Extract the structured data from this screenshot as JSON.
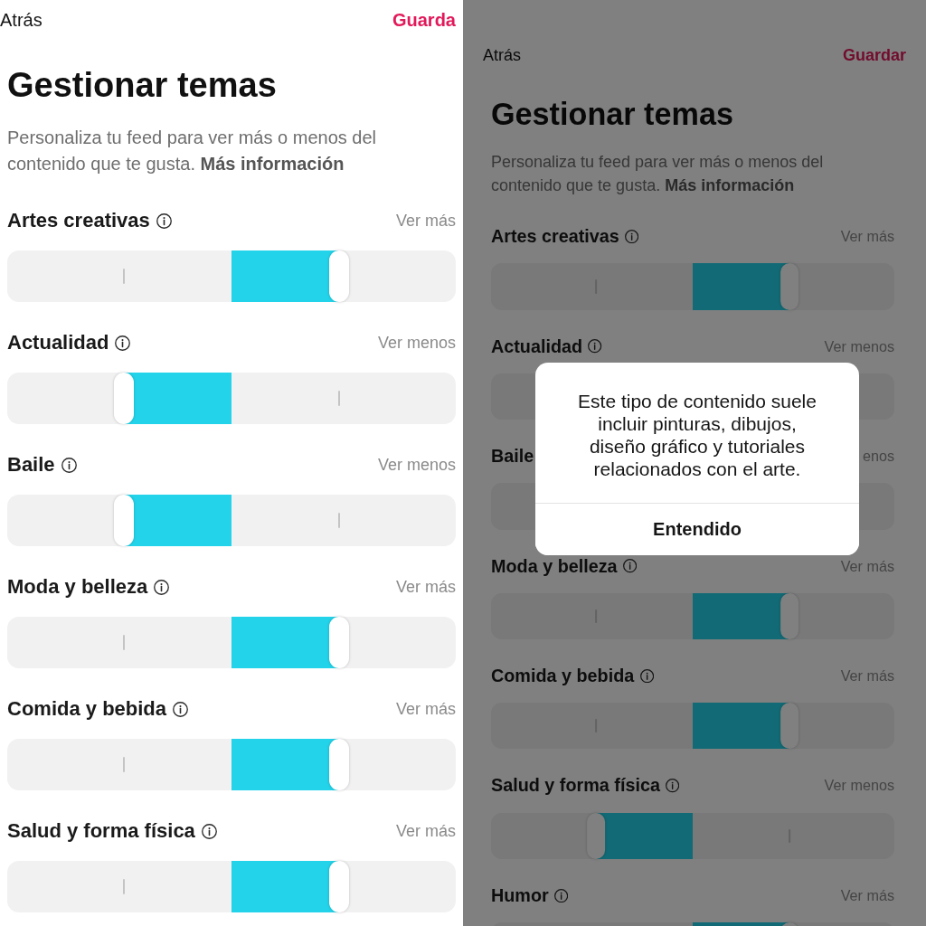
{
  "screens": [
    {
      "dimmed": false,
      "nav": {
        "back": "Atrás",
        "save": "Guarda"
      },
      "title": "Gestionar temas",
      "description": {
        "text": "Personaliza tu feed para ver más o menos del contenido que te gusta.",
        "link": "Más información"
      },
      "topics": [
        {
          "label": "Artes creativas",
          "info": true,
          "preference": "Ver más",
          "level": 0.74
        },
        {
          "label": "Actualidad",
          "info": true,
          "preference": "Ver menos",
          "level": 0.26
        },
        {
          "label": "Baile",
          "info": true,
          "preference": "Ver menos",
          "level": 0.26
        },
        {
          "label": "Moda y belleza",
          "info": true,
          "preference": "Ver más",
          "level": 0.74
        },
        {
          "label": "Comida y bebida",
          "info": true,
          "preference": "Ver más",
          "level": 0.74
        },
        {
          "label": "Salud y forma física",
          "info": true,
          "preference": "Ver más",
          "level": 0.74
        }
      ]
    },
    {
      "dimmed": true,
      "nav": {
        "back": "Atrás",
        "save": "Guardar"
      },
      "title": "Gestionar temas",
      "description": {
        "text": "Personaliza tu feed para ver más o menos del contenido que te gusta.",
        "link": "Más información"
      },
      "topics": [
        {
          "label": "Artes creativas",
          "info": true,
          "preference": "Ver más",
          "level": 0.74
        },
        {
          "label": "Actualidad",
          "info": true,
          "preference": "Ver menos"
        },
        {
          "label": "Baile",
          "info": false,
          "preference": "enos"
        },
        {
          "label": "Moda y belleza",
          "info": true,
          "preference": "Ver más",
          "level": 0.74
        },
        {
          "label": "Comida y bebida",
          "info": true,
          "preference": "Ver más",
          "level": 0.74
        },
        {
          "label": "Salud y forma física",
          "info": true,
          "preference": "Ver menos",
          "level": 0.26
        },
        {
          "label": "Humor",
          "info": true,
          "preference": "Ver más",
          "level": 0.74
        }
      ],
      "dialog": {
        "message": "Este tipo de contenido suele incluir pinturas, dibujos, diseño gráfico y tutoriales relacionados con el arte.",
        "button": "Entendido"
      }
    }
  ]
}
